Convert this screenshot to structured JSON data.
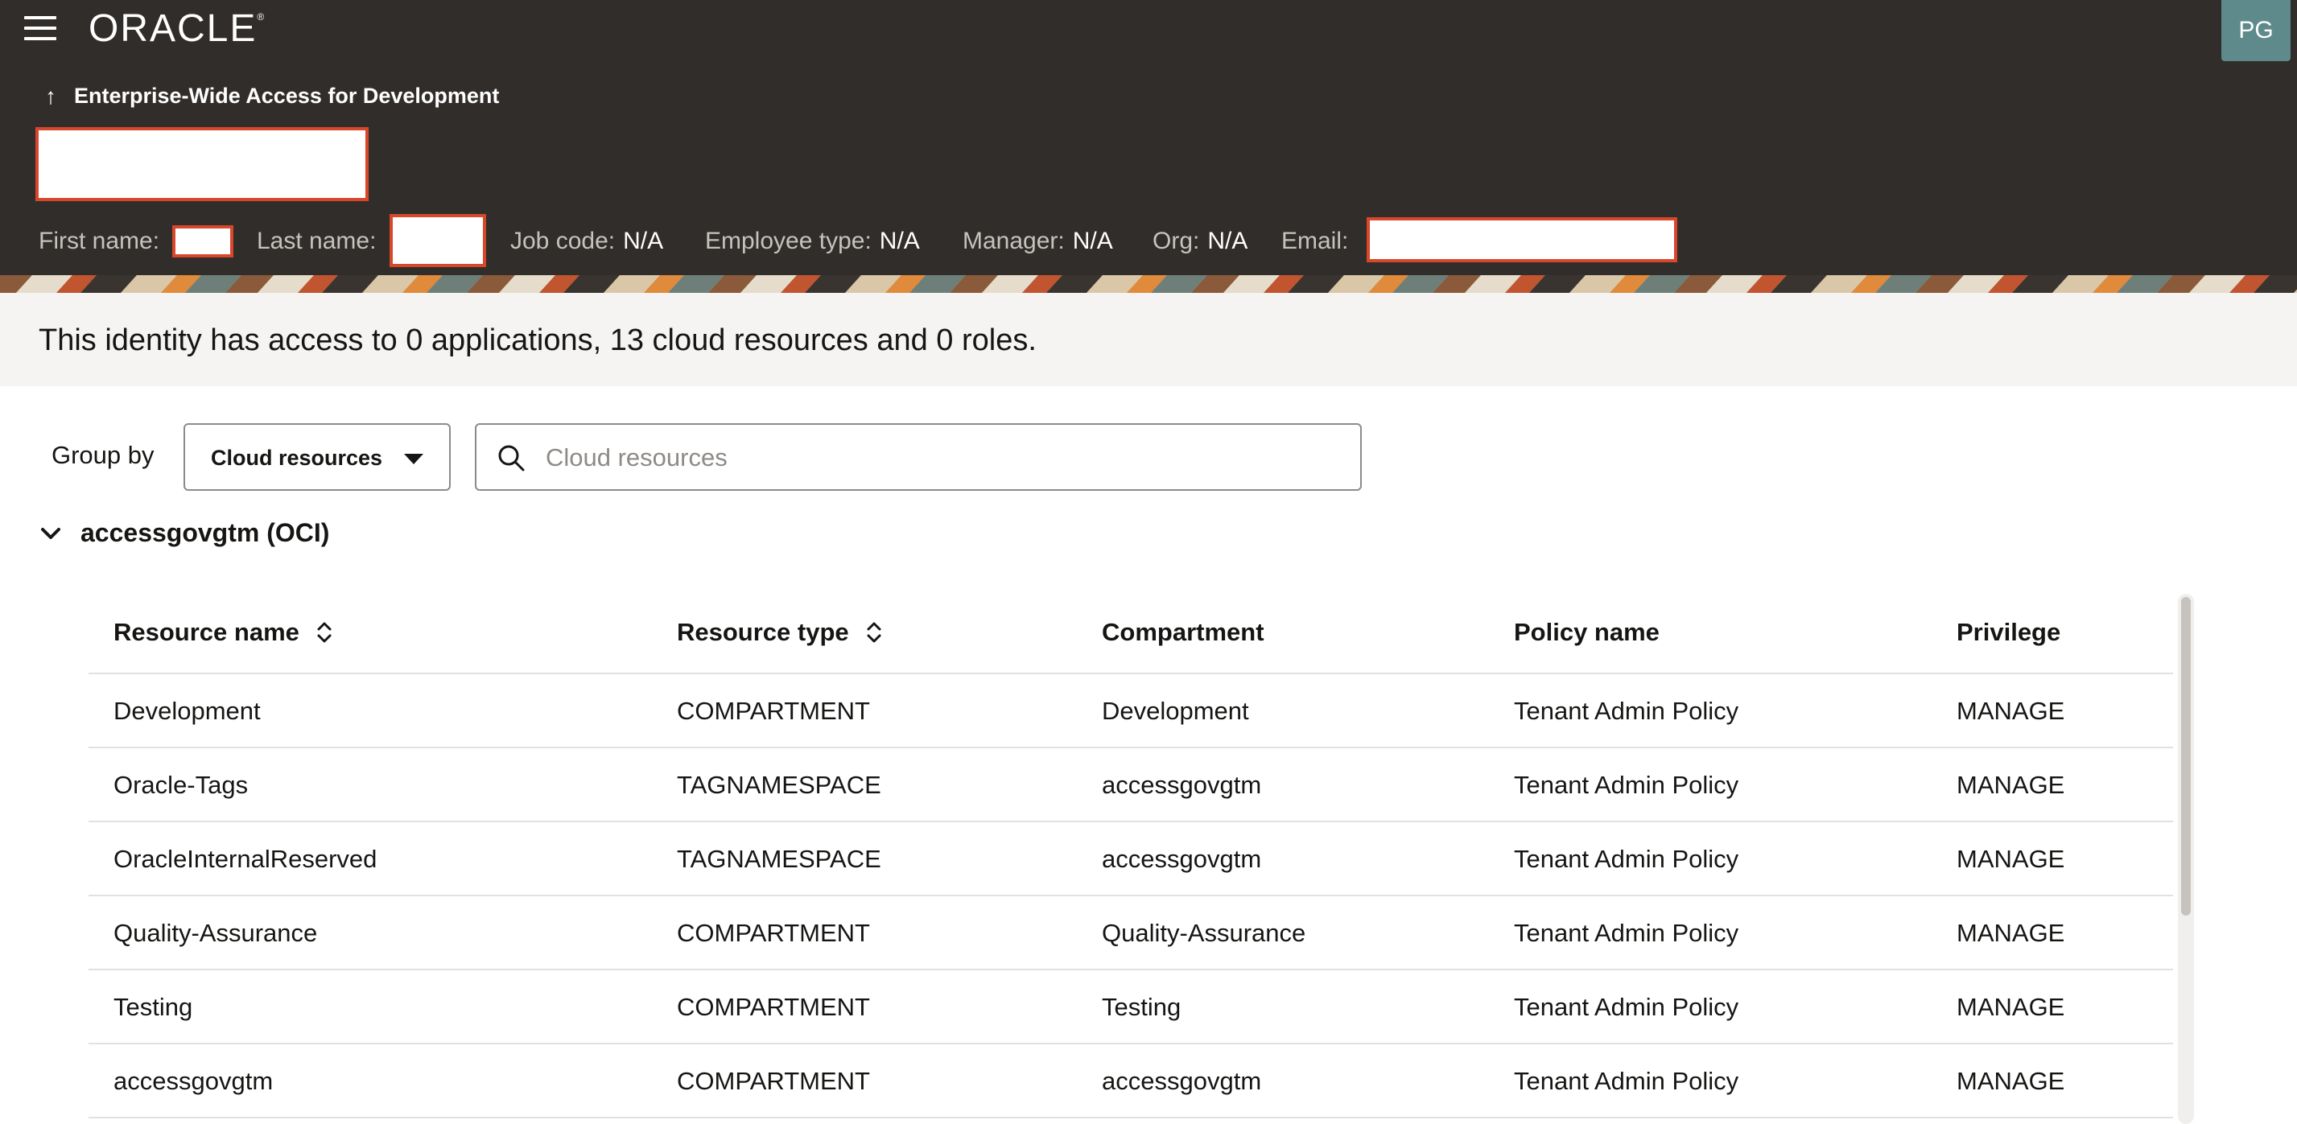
{
  "app": {
    "logo": "ORACLE",
    "logo_mark": "®",
    "avatar_initials": "PG"
  },
  "header": {
    "back_label": "Enterprise-Wide Access for Development",
    "meta": {
      "first_name_label": "First name:",
      "last_name_label": "Last name:",
      "job_code_label": "Job code:",
      "job_code_value": "N/A",
      "employee_type_label": "Employee type:",
      "employee_type_value": "N/A",
      "manager_label": "Manager:",
      "manager_value": "N/A",
      "org_label": "Org:",
      "org_value": "N/A",
      "email_label": "Email:"
    }
  },
  "summary": {
    "text": "This identity has access to 0 applications, 13 cloud resources and 0 roles."
  },
  "toolbar": {
    "group_by_label": "Group by",
    "group_by_value": "Cloud resources",
    "search_placeholder": "Cloud resources"
  },
  "group": {
    "title": "accessgovgtm (OCI)"
  },
  "table": {
    "columns": [
      "Resource name",
      "Resource type",
      "Compartment",
      "Policy name",
      "Privilege"
    ],
    "rows": [
      [
        "Development",
        "COMPARTMENT",
        "Development",
        "Tenant Admin Policy",
        "MANAGE"
      ],
      [
        "Oracle-Tags",
        "TAGNAMESPACE",
        "accessgovgtm",
        "Tenant Admin Policy",
        "MANAGE"
      ],
      [
        "OracleInternalReserved",
        "TAGNAMESPACE",
        "accessgovgtm",
        "Tenant Admin Policy",
        "MANAGE"
      ],
      [
        "Quality-Assurance",
        "COMPARTMENT",
        "Quality-Assurance",
        "Tenant Admin Policy",
        "MANAGE"
      ],
      [
        "Testing",
        "COMPARTMENT",
        "Testing",
        "Tenant Admin Policy",
        "MANAGE"
      ],
      [
        "accessgovgtm",
        "COMPARTMENT",
        "accessgovgtm",
        "Tenant Admin Policy",
        "MANAGE"
      ]
    ]
  },
  "colors": {
    "header_bg": "#312d2a",
    "redaction_border": "#d9472b",
    "summary_bg": "#f5f4f2",
    "avatar_bg": "#5f8a8b"
  }
}
